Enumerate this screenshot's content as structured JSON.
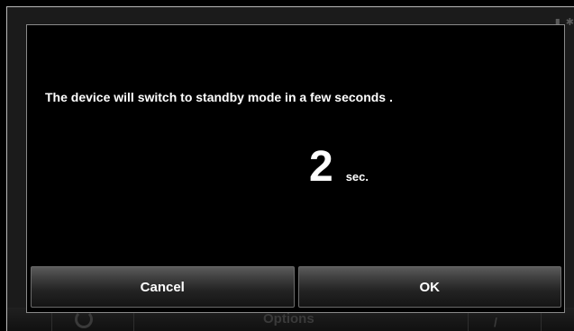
{
  "background": {
    "status_icons": [
      "signal-icon",
      "settings-icon"
    ],
    "bottom_bar": {
      "options_label": "Options"
    }
  },
  "dialog": {
    "message": "The device will switch to standby mode in a few seconds .",
    "countdown_value": "2",
    "countdown_unit": "sec.",
    "buttons": {
      "cancel": "Cancel",
      "ok": "OK"
    }
  },
  "colors": {
    "dialog_background": "#000000",
    "text": "#ffffff",
    "frame": "#b9b9b9",
    "button_top": "#5b5b5b",
    "button_bottom": "#141414"
  }
}
